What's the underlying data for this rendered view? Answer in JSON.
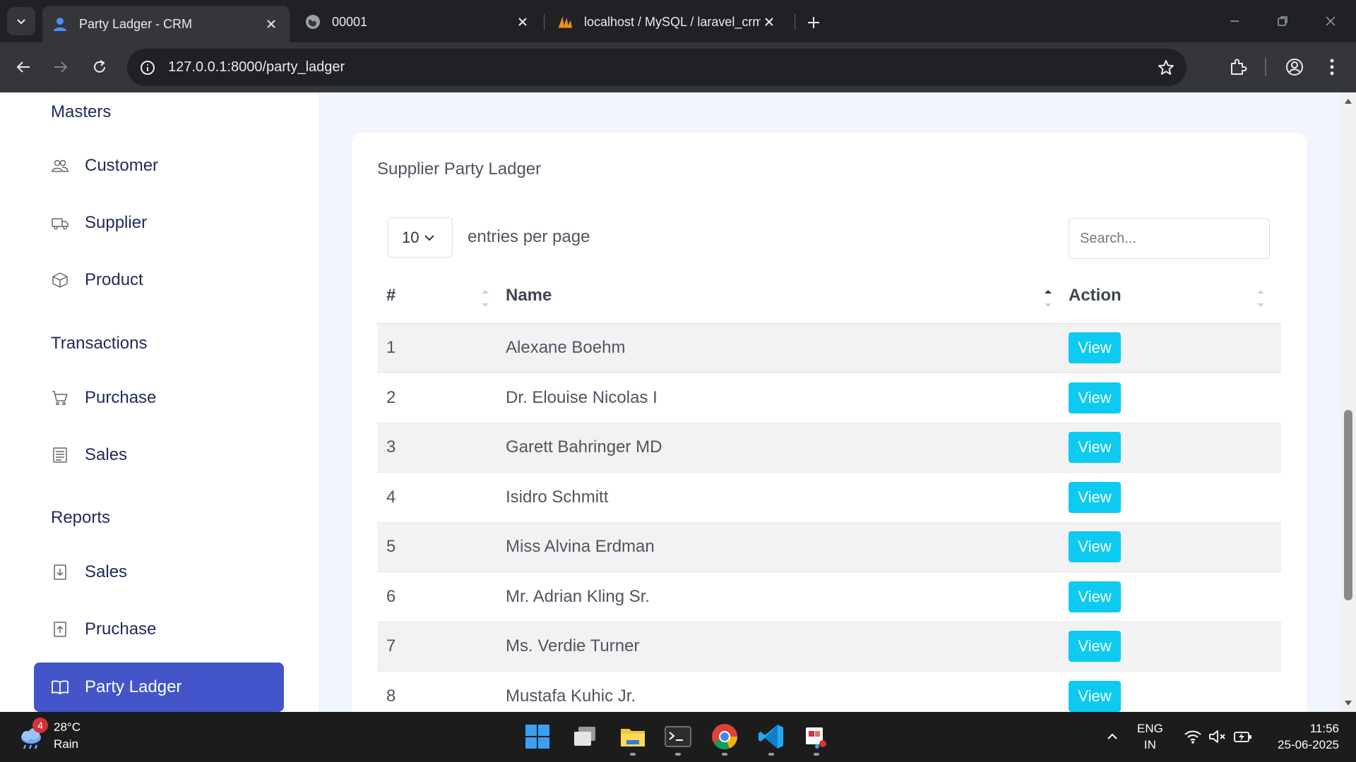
{
  "browser": {
    "tabs": [
      {
        "title": "Party Ladger - CRM",
        "active": true
      },
      {
        "title": "00001",
        "active": false
      },
      {
        "title": "localhost / MySQL / laravel_crm",
        "active": false
      }
    ],
    "url": "127.0.0.1:8000/party_ladger"
  },
  "sidebar": {
    "sections": [
      {
        "heading": "Masters",
        "items": [
          {
            "label": "Customer",
            "icon": "users-icon"
          },
          {
            "label": "Supplier",
            "icon": "truck-icon"
          },
          {
            "label": "Product",
            "icon": "box-icon"
          }
        ]
      },
      {
        "heading": "Transactions",
        "items": [
          {
            "label": "Purchase",
            "icon": "cart-icon"
          },
          {
            "label": "Sales",
            "icon": "receipt-icon"
          }
        ]
      },
      {
        "heading": "Reports",
        "items": [
          {
            "label": "Sales",
            "icon": "download-file-icon"
          },
          {
            "label": "Pruchase",
            "icon": "upload-file-icon"
          },
          {
            "label": "Party Ladger",
            "icon": "book-icon",
            "active": true
          }
        ]
      }
    ],
    "active_color": "#4355c9"
  },
  "main": {
    "title": "Supplier Party Ladger",
    "per_page": "10",
    "per_page_label": "entries per page",
    "search_placeholder": "Search...",
    "columns": [
      "#",
      "Name",
      "Action"
    ],
    "rows": [
      {
        "num": "1",
        "name": "Alexane Boehm",
        "action": "View"
      },
      {
        "num": "2",
        "name": "Dr. Elouise Nicolas I",
        "action": "View"
      },
      {
        "num": "3",
        "name": "Garett Bahringer MD",
        "action": "View"
      },
      {
        "num": "4",
        "name": "Isidro Schmitt",
        "action": "View"
      },
      {
        "num": "5",
        "name": "Miss Alvina Erdman",
        "action": "View"
      },
      {
        "num": "6",
        "name": "Mr. Adrian Kling Sr.",
        "action": "View"
      },
      {
        "num": "7",
        "name": "Ms. Verdie Turner",
        "action": "View"
      },
      {
        "num": "8",
        "name": "Mustafa Kuhic Jr.",
        "action": "View"
      }
    ],
    "view_button_color": "#0dcaf0"
  },
  "taskbar": {
    "weather_badge": "4",
    "temperature": "28°C",
    "condition": "Rain",
    "lang_1": "ENG",
    "lang_2": "IN",
    "time": "11:56",
    "date": "25-06-2025"
  }
}
